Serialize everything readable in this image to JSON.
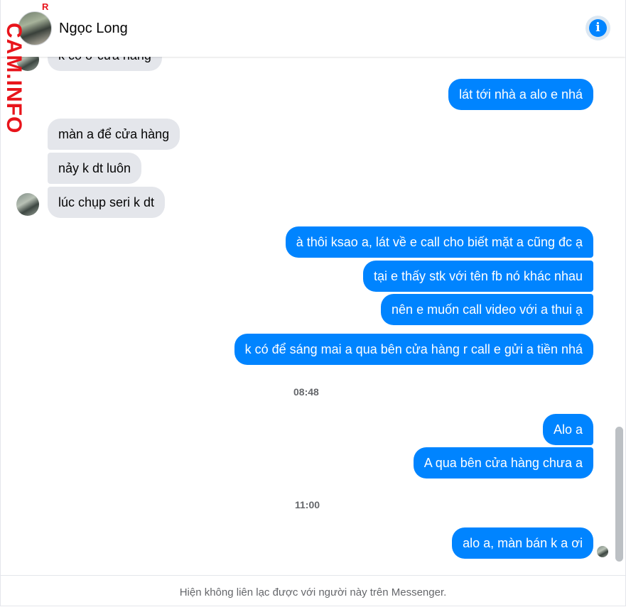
{
  "header": {
    "contact_name": "Ngọc Long",
    "info_icon": "info-icon"
  },
  "watermark": {
    "text": "CAM.INFO",
    "extra": "R"
  },
  "messages": {
    "m0": "k có ở cửa hàng",
    "m1": "lát tới nhà a alo e nhá",
    "m2": "màn a để cửa hàng",
    "m3": "nảy k dt luôn",
    "m4": "lúc chụp seri k dt",
    "m5": "à thôi ksao a, lát về e call cho biết mặt a cũng đc ạ",
    "m6": "tại e thấy stk với tên fb nó khác nhau",
    "m7": "nên e muốn call video với a thui ạ",
    "m8": "k có để sáng mai a qua bên cửa hàng r call e gửi a tiền nhá",
    "m9": "Alo a",
    "m10": "A qua bên cửa hàng chưa a",
    "m11": "alo a, màn bán k a ơi"
  },
  "timestamps": {
    "t1": "08:48",
    "t2": "11:00"
  },
  "footer": {
    "notice": "Hiện không liên lạc được với người này trên Messenger."
  },
  "colors": {
    "outgoing": "#0084ff",
    "incoming": "#e4e6eb",
    "watermark": "#e8141b"
  }
}
